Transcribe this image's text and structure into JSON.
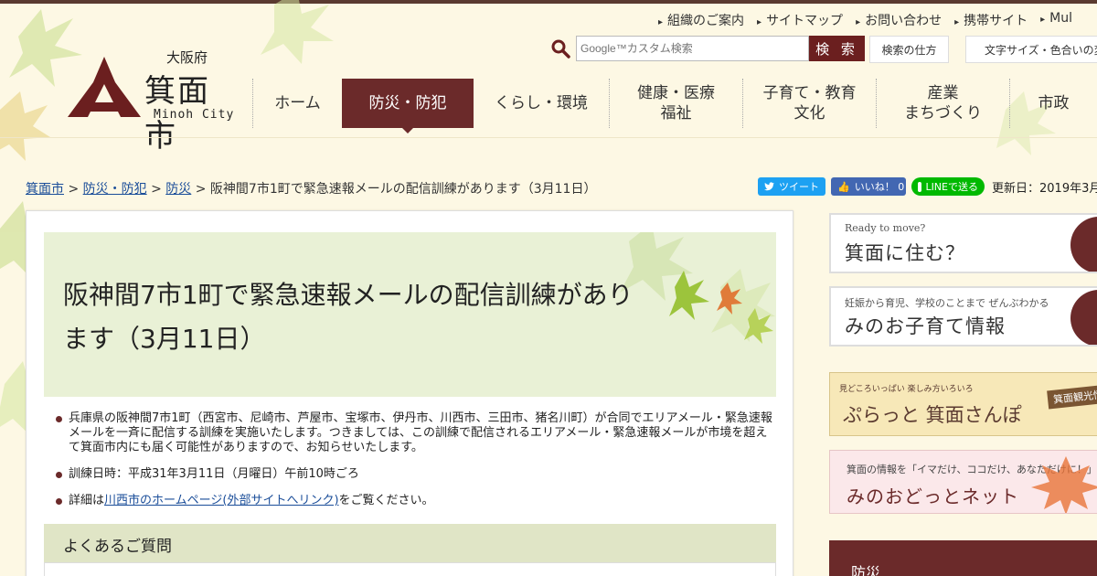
{
  "logo": {
    "prefecture": "大阪府",
    "city": "箕面市",
    "city_en": "Minoh City"
  },
  "utility_links": [
    {
      "label": "組織のご案内"
    },
    {
      "label": "サイトマップ"
    },
    {
      "label": "お問い合わせ"
    },
    {
      "label": "携帯サイト"
    },
    {
      "label": "Mul"
    }
  ],
  "search": {
    "placeholder": "Google™カスタム検索",
    "button_label": "検 索",
    "howto_label": "検索の仕方"
  },
  "font_size_button": "文字サイズ・色合いの変",
  "global_nav": [
    {
      "line1": "ホーム",
      "line2": ""
    },
    {
      "line1": "防災・防犯",
      "line2": ""
    },
    {
      "line1": "くらし・環境",
      "line2": ""
    },
    {
      "line1": "健康・医療",
      "line2": "福祉"
    },
    {
      "line1": "子育て・教育",
      "line2": "文化"
    },
    {
      "line1": "産業",
      "line2": "まちづくり"
    },
    {
      "line1": "市政",
      "line2": ""
    }
  ],
  "breadcrumb": {
    "items": [
      "箕面市",
      "防災・防犯",
      "防災"
    ],
    "separator": " > ",
    "current": "阪神間7市1町で緊急速報メールの配信訓練があります（3月11日）"
  },
  "share": {
    "tweet": "ツイート",
    "like": "いいね！ 0",
    "line": "LINEで送る"
  },
  "updated": "更新日：2019年3月",
  "article": {
    "title": "阪神間7市1町で緊急速報メールの配信訓練があります（3月11日）",
    "p1": "兵庫県の阪神間7市1町（西宮市、尼崎市、芦屋市、宝塚市、伊丹市、川西市、三田市、猪名川町）が合同でエリアメール・緊急速報メールを一斉に配信する訓練を実施いたします。つきましては、この訓練で配信されるエリアメール・緊急速報メールが市境を超えて箕面市内にも届く可能性がありますので、お知らせいたします。",
    "p2": "訓練日時：平成31年3月11日（月曜日）午前10時ごろ",
    "p3_prefix": "詳細は",
    "p3_link": "川西市のホームページ(外部サイトへリンク)",
    "p3_suffix": "をご覧ください。",
    "faq_heading": "よくあるご質問"
  },
  "sidebar": {
    "b1_small": "Ready to move?",
    "b1_big": "箕面に住む？",
    "b2_small": "妊娠から育児、学校のことまで ぜんぶわかる",
    "b2_big": "みのお子育て情報",
    "b3_small": "見どころいっぱい 楽しみ方いろいろ",
    "b3_big": "ぷらっと 箕面さんぽ",
    "b3_tag": "箕面観光情",
    "b4_small": "箕面の情報を「イマだけ、ココだけ、あなただけに！」",
    "b4_big": "みのおどっとネット",
    "b5": "防災"
  },
  "colors": {
    "brand": "#6b2a2a",
    "background": "#fdf8e4",
    "title_bg": "#e9f1d6",
    "link": "#1a4d99"
  }
}
